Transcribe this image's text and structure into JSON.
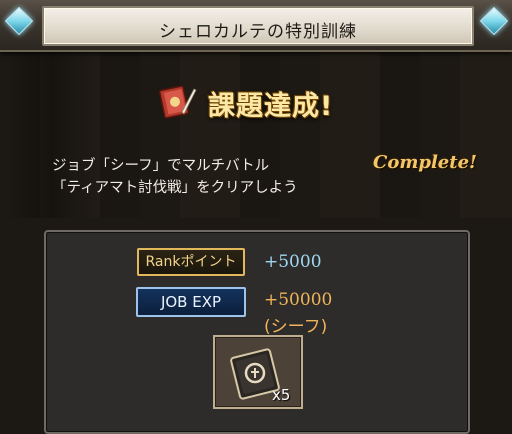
{
  "header": {
    "title": "シェロカルテの特別訓練"
  },
  "banner": {
    "achieve_text": "課題達成!"
  },
  "mission": {
    "line1": "ジョブ「シーフ」でマルチバトル",
    "line2": "「ティアマト討伐戦」をクリアしよう",
    "status": "Complete!"
  },
  "rewards": {
    "rank_label": "Rankポイント",
    "rank_value": "+5000",
    "jobexp_label": "JOB EXP",
    "jobexp_value": "+50000",
    "jobexp_job": "(シーフ)",
    "item_count": "x5",
    "item_icon": "book-icon"
  },
  "colors": {
    "rank_badge_border": "#e3b85c",
    "jobexp_badge_border": "#9ec3ea",
    "rank_value": "#9fd8f4",
    "jobexp_value": "#f0b45a",
    "complete": "#f3c66a"
  }
}
